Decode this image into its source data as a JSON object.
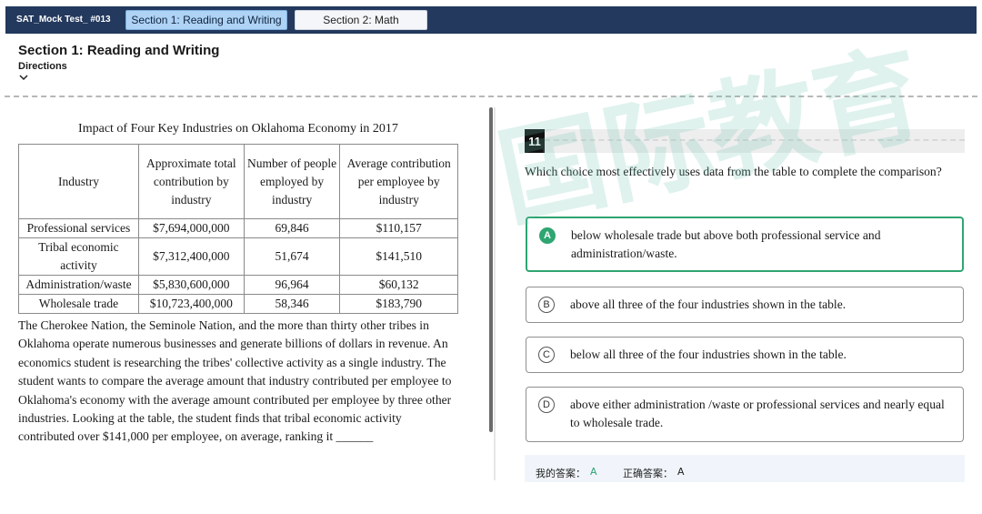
{
  "header": {
    "test_name": "SAT_Mock Test_ #013",
    "tabs": [
      {
        "label": "Section 1: Reading and Writing",
        "active": true
      },
      {
        "label": "Section 2: Math",
        "active": false
      }
    ],
    "section_title": "Section 1: Reading and Writing",
    "directions_label": "Directions"
  },
  "table": {
    "title": "Impact of Four Key Industries on Oklahoma Economy in 2017",
    "columns": [
      "Industry",
      "Approximate total contribution by industry",
      "Number of people employed by industry",
      "Average contribution per employee by industry"
    ],
    "rows": [
      [
        "Professional services",
        "$7,694,000,000",
        "69,846",
        "$110,157"
      ],
      [
        "Tribal economic activity",
        "$7,312,400,000",
        "51,674",
        "$141,510"
      ],
      [
        "Administration/waste",
        "$5,830,600,000",
        "96,964",
        "$60,132"
      ],
      [
        "Wholesale trade",
        "$10,723,400,000",
        "58,346",
        "$183,790"
      ]
    ]
  },
  "passage": "The Cherokee Nation, the Seminole Nation, and the more than thirty other tribes in Oklahoma operate numerous businesses and generate billions of dollars in revenue. An economics student is researching the tribes' collective activity as a single industry. The student wants to compare the average amount that industry contributed per employee to Oklahoma's economy with the average amount contributed per employee by three other industries. Looking at the table, the student finds that tribal economic activity contributed over $141,000 per employee, on average, ranking it ______",
  "question": {
    "number": "11",
    "stem": "Which choice most effectively uses data from the table to complete the comparison?",
    "options": [
      {
        "letter": "A",
        "text": "below wholesale trade but above both professional service and administration/waste.",
        "selected": true
      },
      {
        "letter": "B",
        "text": "above all three of the four industries shown in the table.",
        "selected": false
      },
      {
        "letter": "C",
        "text": "below all three of the four industries shown in the table.",
        "selected": false
      },
      {
        "letter": "D",
        "text": "above either administration /waste or professional services and nearly equal to wholesale trade.",
        "selected": false
      }
    ]
  },
  "answers": {
    "my_answer_label": "我的答案：",
    "my_answer": "A",
    "correct_answer_label": "正确答案：",
    "correct_answer": "A"
  },
  "watermark": {
    "text": "国际教育",
    "color": "#6fc3b2"
  }
}
